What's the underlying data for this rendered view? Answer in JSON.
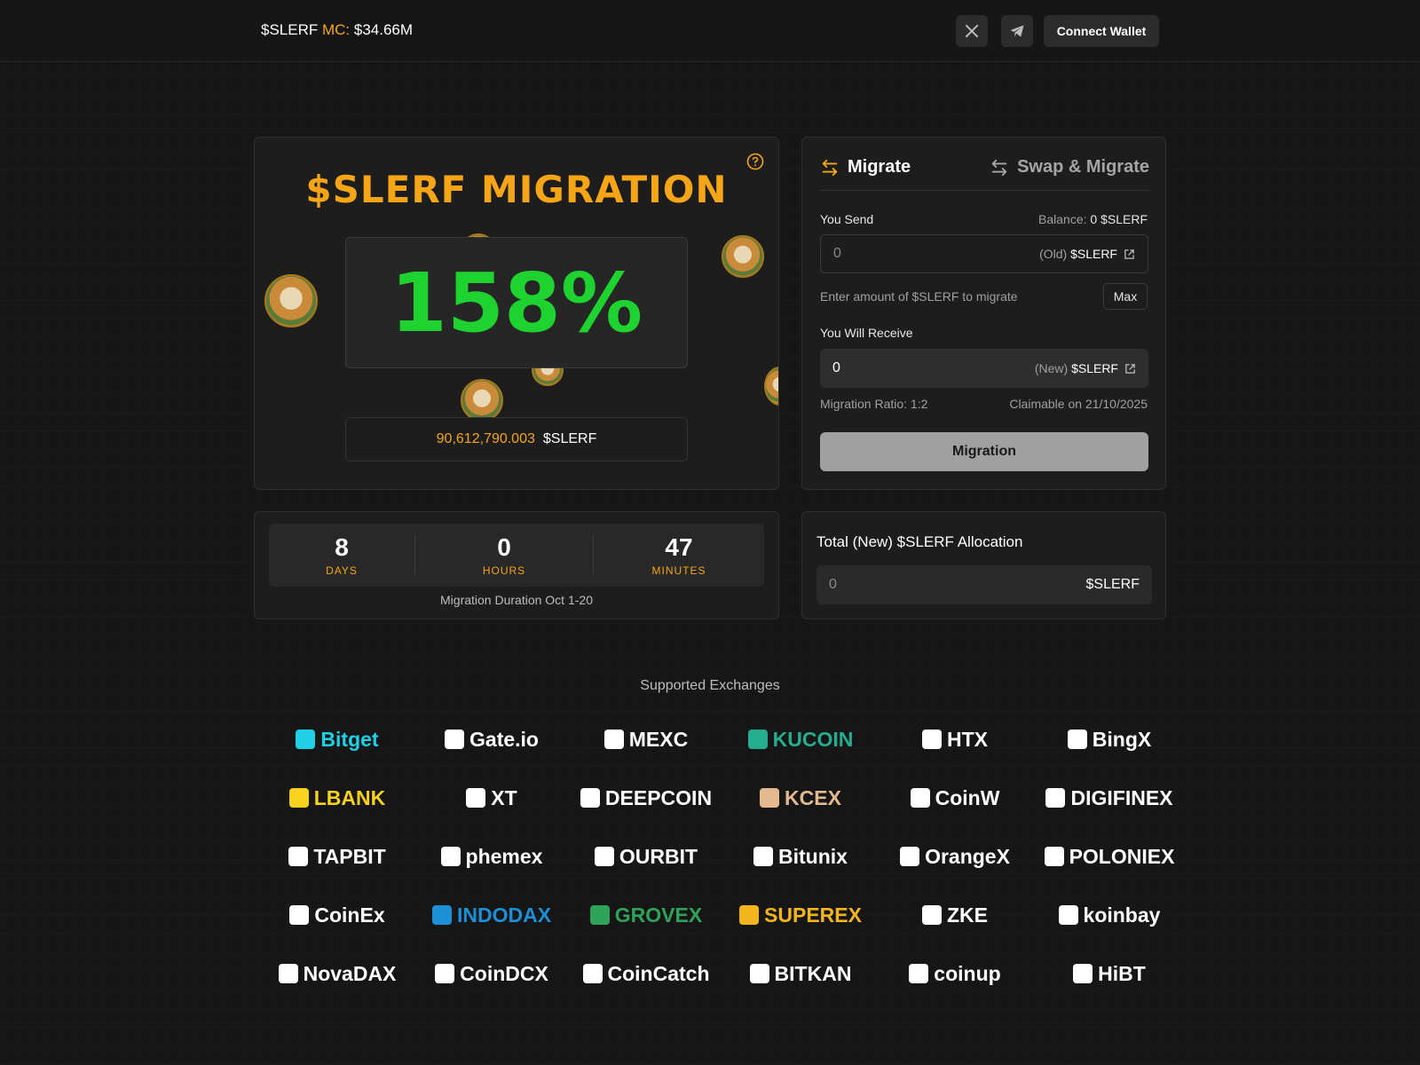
{
  "header": {
    "token": "$SLERF",
    "mc_label": "MC:",
    "mc_value": "$34.66M",
    "connect_label": "Connect Wallet",
    "icons": [
      "x-icon",
      "telegram-icon"
    ]
  },
  "migration": {
    "title": "$SLERF MIGRATION",
    "percent": "158%",
    "amount": "90,612,790.003",
    "amount_token": "$SLERF"
  },
  "swap": {
    "tab_migrate": "Migrate",
    "tab_swap": "Swap & Migrate",
    "you_send": "You Send",
    "balance_label": "Balance:",
    "balance_value": "0 $SLERF",
    "send_value": "0",
    "send_prefix": "(Old)",
    "send_token": "$SLERF",
    "hint": "Enter amount of $SLERF to migrate",
    "max_label": "Max",
    "you_receive": "You Will Receive",
    "recv_value": "0",
    "recv_prefix": "(New)",
    "recv_token": "$SLERF",
    "ratio": "Migration Ratio: 1:2",
    "claimable": "Claimable on 21/10/2025",
    "button": "Migration"
  },
  "countdown": {
    "days": "8",
    "days_label": "DAYS",
    "hours": "0",
    "hours_label": "HOURS",
    "minutes": "47",
    "minutes_label": "MINUTES",
    "footer": "Migration Duration Oct 1-20"
  },
  "allocation": {
    "title": "Total (New) $SLERF Allocation",
    "value": "0",
    "token": "$SLERF"
  },
  "exchanges": {
    "title": "Supported Exchanges",
    "items": [
      {
        "name": "Bitget",
        "color": "#1fd0e6"
      },
      {
        "name": "Gate.io",
        "color": "#ffffff"
      },
      {
        "name": "MEXC",
        "color": "#ffffff"
      },
      {
        "name": "KUCOIN",
        "color": "#24ae8f"
      },
      {
        "name": "HTX",
        "color": "#ffffff"
      },
      {
        "name": "BingX",
        "color": "#ffffff"
      },
      {
        "name": "LBANK",
        "color": "#f8d21c"
      },
      {
        "name": "XT",
        "color": "#ffffff"
      },
      {
        "name": "DEEPCOIN",
        "color": "#ffffff"
      },
      {
        "name": "KCEX",
        "color": "#e3b98f"
      },
      {
        "name": "CoinW",
        "color": "#ffffff"
      },
      {
        "name": "DIGIFINEX",
        "color": "#ffffff"
      },
      {
        "name": "TAPBIT",
        "color": "#ffffff"
      },
      {
        "name": "phemex",
        "color": "#ffffff"
      },
      {
        "name": "OURBIT",
        "color": "#ffffff"
      },
      {
        "name": "Bitunix",
        "color": "#ffffff"
      },
      {
        "name": "OrangeX",
        "color": "#ffffff"
      },
      {
        "name": "POLONIEX",
        "color": "#ffffff"
      },
      {
        "name": "CoinEx",
        "color": "#ffffff"
      },
      {
        "name": "INDODAX",
        "color": "#1c8fd6"
      },
      {
        "name": "GROVEX",
        "color": "#2fa35a"
      },
      {
        "name": "SUPEREX",
        "color": "#f5b51c"
      },
      {
        "name": "ZKE",
        "color": "#ffffff"
      },
      {
        "name": "koinbay",
        "color": "#ffffff"
      },
      {
        "name": "NovaDAX",
        "color": "#ffffff"
      },
      {
        "name": "CoinDCX",
        "color": "#ffffff"
      },
      {
        "name": "CoinCatch",
        "color": "#ffffff"
      },
      {
        "name": "BITKAN",
        "color": "#ffffff"
      },
      {
        "name": "coinup",
        "color": "#ffffff"
      },
      {
        "name": "HiBT",
        "color": "#ffffff"
      }
    ]
  },
  "colors": {
    "accent": "#f5a516",
    "percent_green": "#1ed32f",
    "background": "#161616"
  }
}
